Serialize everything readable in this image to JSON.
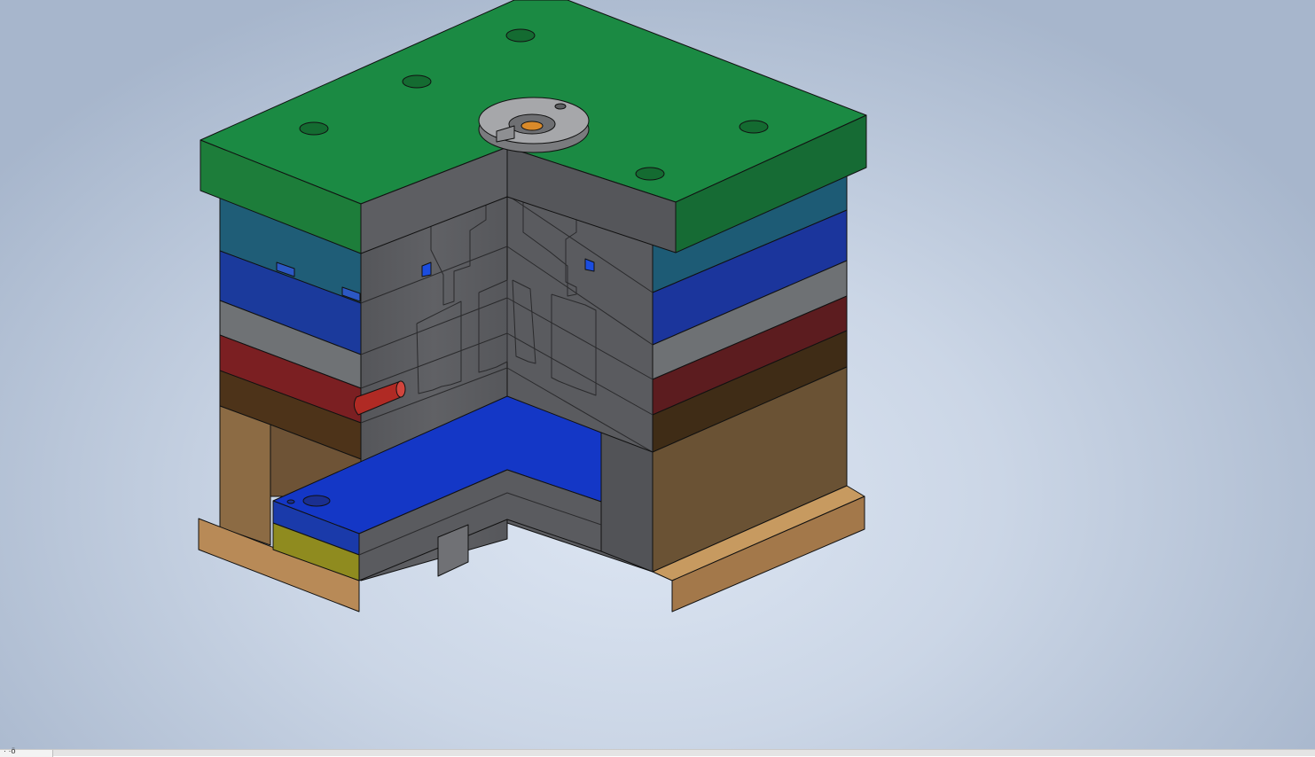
{
  "viewport": {
    "background_top": "#a7b6cc",
    "background_center": "#dde6f3"
  },
  "model": {
    "name_icon": "mold-assembly-section-view",
    "plate_colors": {
      "clamp_plate_top": "#1b8a43",
      "cavity_plate_teal": "#1e5c78",
      "cavity_plate_blue": "#1b35a0",
      "gray_plate": "#6e7174",
      "red_plate": "#7a1e22",
      "brown_plate": "#4f3418",
      "spacer_block": "#8a6a44",
      "base_plate": "#c2945e",
      "ejector_plate": "#1437c4",
      "ejector_retainer": "#8f8a1e",
      "section_face": "#5d5e62",
      "sprue_bushing": "#9c9c9e",
      "gate": "#d98a2a"
    }
  },
  "statusbar": {
    "text": "· ·ö"
  }
}
